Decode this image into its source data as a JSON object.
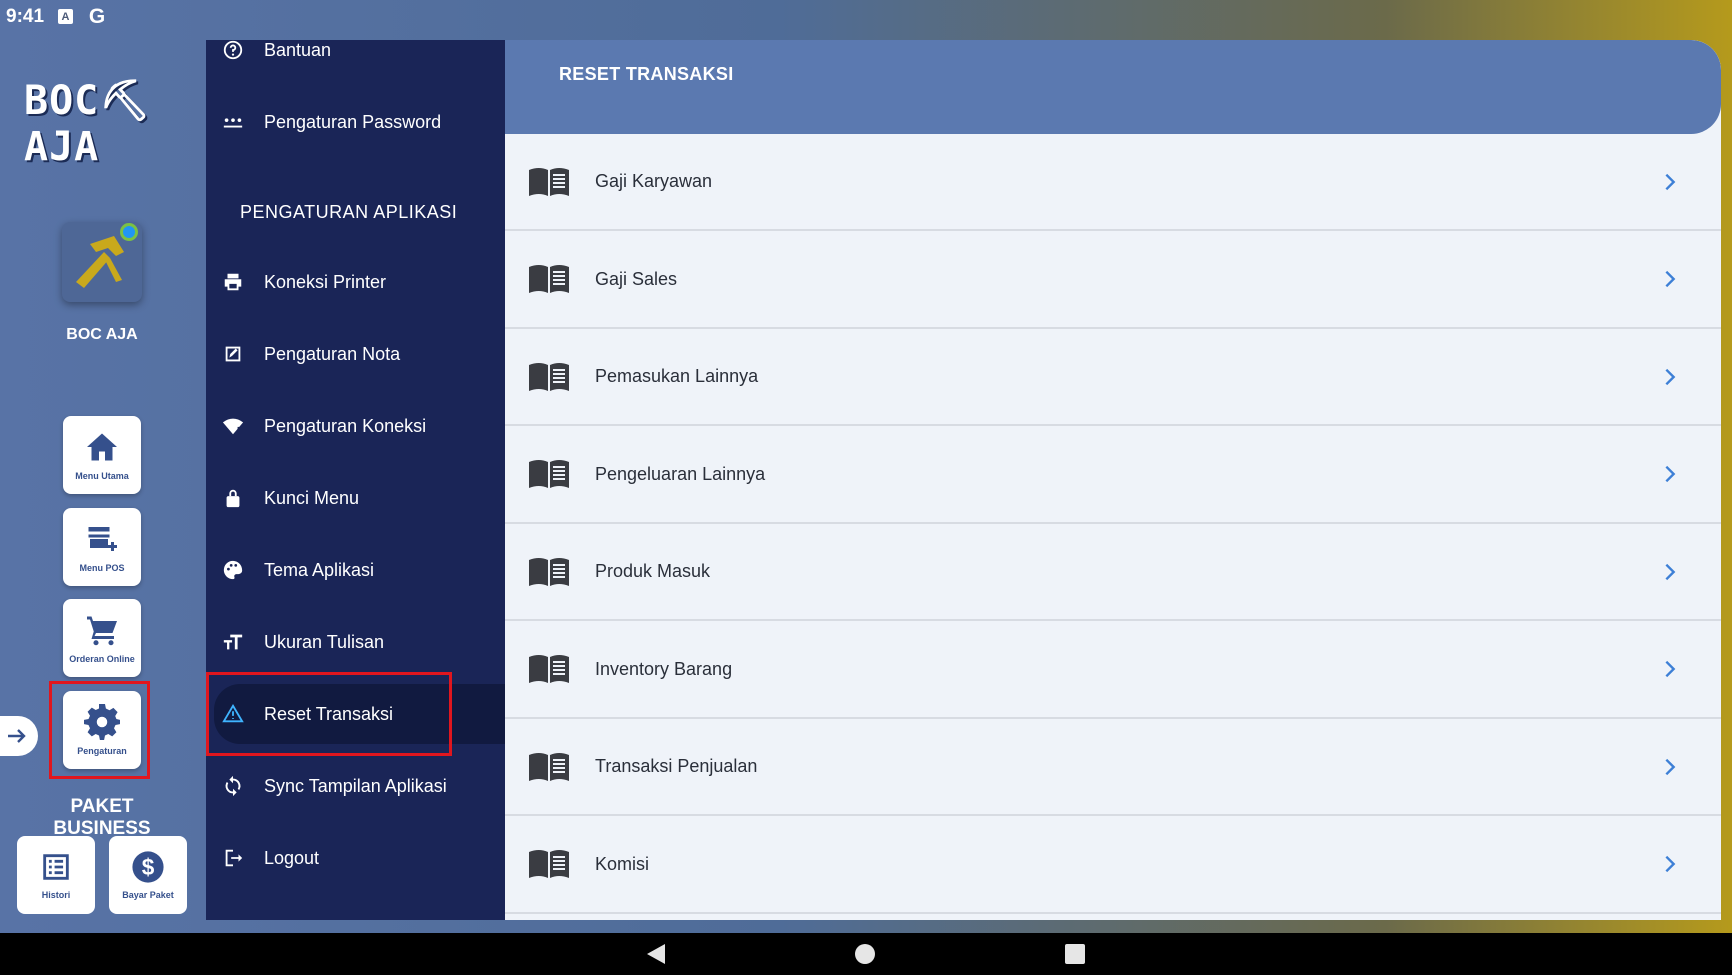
{
  "status": {
    "time": "9:41"
  },
  "brand": {
    "logo_text": "BOC⛏AJA",
    "name": "BOC AJA"
  },
  "rail": [
    {
      "label": "Menu Utama",
      "icon": "home-icon"
    },
    {
      "label": "Menu POS",
      "icon": "store-icon"
    },
    {
      "label": "Orderan Online",
      "icon": "cart-icon"
    },
    {
      "label": "Pengaturan",
      "icon": "gear-icon"
    }
  ],
  "paket": {
    "title": "PAKET BUSINESS",
    "histori": "Histori",
    "bayar": "Bayar Paket"
  },
  "drawer": {
    "top_items": [
      {
        "label": "Bantuan",
        "icon": "help-icon"
      },
      {
        "label": "Pengaturan Password",
        "icon": "password-icon"
      }
    ],
    "section_title": "PENGATURAN APLIKASI",
    "items": [
      {
        "label": "Koneksi Printer",
        "icon": "printer-icon"
      },
      {
        "label": "Pengaturan Nota",
        "icon": "note-edit-icon"
      },
      {
        "label": "Pengaturan Koneksi",
        "icon": "wifi-icon"
      },
      {
        "label": "Kunci Menu",
        "icon": "lock-icon"
      },
      {
        "label": "Tema Aplikasi",
        "icon": "palette-icon"
      },
      {
        "label": "Ukuran Tulisan",
        "icon": "text-size-icon"
      },
      {
        "label": "Reset Transaksi",
        "icon": "warning-icon"
      },
      {
        "label": "Sync Tampilan Aplikasi",
        "icon": "sync-icon"
      },
      {
        "label": "Logout",
        "icon": "logout-icon"
      }
    ]
  },
  "main": {
    "title": "RESET TRANSAKSI",
    "rows": [
      "Gaji Karyawan",
      "Gaji Sales",
      "Pemasukan Lainnya",
      "Pengeluaran Lainnya",
      "Produk Masuk",
      "Inventory Barang",
      "Transaksi Penjualan",
      "Komisi"
    ]
  },
  "colors": {
    "accent": "#1a2557",
    "header": "#5b79b0",
    "highlight": "#e0161e",
    "chevron": "#3d7fd6"
  }
}
